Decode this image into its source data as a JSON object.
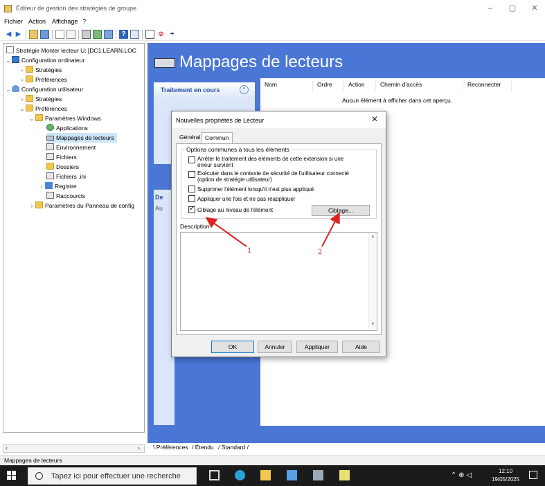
{
  "window": {
    "title": "Éditeur de gestion des stratégies de groupe",
    "minimize": "–",
    "maximize": "▢",
    "close": "✕"
  },
  "menu": [
    "Fichier",
    "Action",
    "Affichage",
    "?"
  ],
  "tree": {
    "root": "Stratégie Monter lecteur U: [DC1.LEARN.LOC",
    "items": [
      {
        "label": "Configuration ordinateur"
      },
      {
        "label": "Stratégies"
      },
      {
        "label": "Préférences"
      },
      {
        "label": "Configuration utilisateur"
      },
      {
        "label": "Stratégies"
      },
      {
        "label": "Préférences"
      },
      {
        "label": "Paramètres Windows"
      },
      {
        "label": "Applications"
      },
      {
        "label": "Mappages de lecteurs"
      },
      {
        "label": "Environnement"
      },
      {
        "label": "Fichiers"
      },
      {
        "label": "Dossiers"
      },
      {
        "label": "Fichiers .ini"
      },
      {
        "label": "Registre"
      },
      {
        "label": "Raccourcis"
      },
      {
        "label": "Paramètres du Panneau de config"
      }
    ]
  },
  "banner": {
    "title": "Mappages de lecteurs"
  },
  "task_panel": {
    "title": "Traitement en cours",
    "collapse": "⌃"
  },
  "desc_panel": {
    "title": "De",
    "sub": "Au"
  },
  "list": {
    "columns": [
      "Nom",
      "Ordre",
      "Action",
      "Chemin d'accès",
      "Reconnecter"
    ],
    "empty_message": "Aucun élément à afficher dans cet aperçu."
  },
  "bottom_tabs": [
    "Préférences",
    "Étendu",
    "Standard"
  ],
  "status": "Mappages de lecteurs",
  "dialog": {
    "title": "Nouvelles propriétés de Lecteur",
    "close": "✕",
    "tabs": [
      "Général",
      "Commun"
    ],
    "group_label": "Options communes à tous les éléments",
    "options": [
      {
        "line1": "Arrêter le traitement des éléments de cette extension si une",
        "line2": "erreur survient",
        "checked": false
      },
      {
        "line1": "Exécuter dans le contexte de sécurité de l'utilisateur connecté",
        "line2": "(option de stratégie utilisateur)",
        "checked": false
      },
      {
        "line1": "Supprimer l'élément lorsqu'il n'est plus appliqué",
        "line2": "",
        "checked": false
      },
      {
        "line1": "Appliquer une fois et ne pas réappliquer",
        "line2": "",
        "checked": false
      },
      {
        "line1": "Ciblage au niveau de l'élément",
        "line2": "",
        "checked": true
      }
    ],
    "ciblage_button": "Ciblage...",
    "description_label": "Description",
    "buttons": {
      "ok": "OK",
      "cancel": "Annuler",
      "apply": "Appliquer",
      "help": "Aide"
    }
  },
  "annotations": {
    "one": "1",
    "two": "2",
    "color": "#dd2222"
  },
  "taskbar": {
    "search_placeholder": "Tapez ici pour effectuer une recherche",
    "time": "12:10",
    "date": "19/05/2025"
  }
}
